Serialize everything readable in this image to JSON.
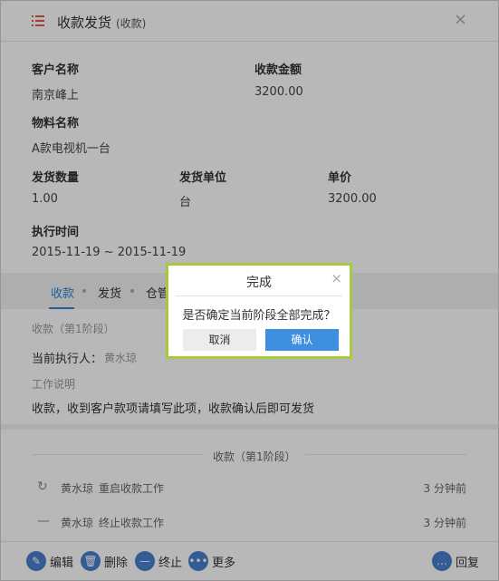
{
  "header": {
    "title": "收款发货",
    "subtitle": "(收款)"
  },
  "fields": {
    "customer_label": "客户名称",
    "customer_value": "南京峰上",
    "amount_label": "收款金额",
    "amount_value": "3200.00",
    "material_label": "物料名称",
    "material_value": "A款电视机一台",
    "qty_label": "发货数量",
    "qty_value": "1.00",
    "unit_label": "发货单位",
    "unit_value": "台",
    "price_label": "单价",
    "price_value": "3200.00",
    "time_label": "执行时间",
    "time_value": "2015-11-19 ~ 2015-11-19"
  },
  "tabs": [
    "收款",
    "发货",
    "仓管"
  ],
  "stage": {
    "name": "收款（第1阶段）",
    "executor_label": "当前执行人：",
    "executor_value": "黄水琼",
    "desc_label": "工作说明",
    "desc_text": "收款，收到客户款项请填写此项，收款确认后即可发货"
  },
  "history": {
    "title": "收款（第1阶段）",
    "rows": [
      {
        "icon": "restart-icon",
        "name": "黄水琼",
        "action": "重启收款工作",
        "time": "3 分钟前"
      },
      {
        "icon": "terminate-icon",
        "name": "黄水琼",
        "action": "终止收款工作",
        "time": "3 分钟前"
      }
    ]
  },
  "footer": {
    "edit": "编辑",
    "delete": "删除",
    "stop": "终止",
    "more": "更多",
    "reply": "回复"
  },
  "dialog": {
    "title": "完成",
    "message": "是否确定当前阶段全部完成？",
    "cancel": "取消",
    "confirm": "确认"
  },
  "colors": {
    "accent": "#2b84d8",
    "dialog_border": "#a7c93a",
    "title_icon": "#e05a46"
  }
}
